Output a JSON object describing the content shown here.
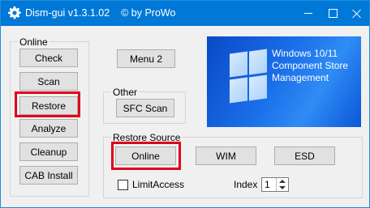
{
  "title": "Dism-gui v1.3.1.02    © by ProWo",
  "online_group": {
    "legend": "Online",
    "buttons": [
      "Check",
      "Scan",
      "Restore",
      "Analyze",
      "Cleanup",
      "CAB Install"
    ]
  },
  "menu2_label": "Menu 2",
  "other_group": {
    "legend": "Other",
    "sfc_label": "SFC Scan"
  },
  "banner": {
    "line1": "Windows 10/11",
    "line2": "Component Store",
    "line3": "Management"
  },
  "restore_source": {
    "legend": "Restore Source",
    "online_label": "Online",
    "wim_label": "WIM",
    "esd_label": "ESD",
    "limitaccess_label": "LimitAccess",
    "limitaccess_checked": false,
    "index_label": "Index",
    "index_value": "1"
  },
  "colors": {
    "titlebar": "#0078d7",
    "highlight": "#e0001b"
  }
}
